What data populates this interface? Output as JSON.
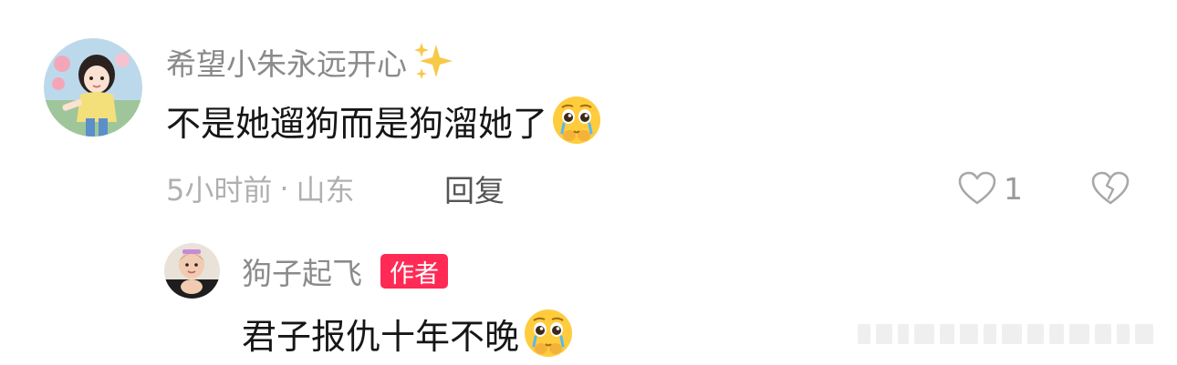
{
  "comment": {
    "username": "希望小朱永远开心",
    "content": "不是她遛狗而是狗溜她了",
    "emoji_icon": "crying-pleading-face-icon",
    "timestamp": "5小时前",
    "separator": "·",
    "location": "山东",
    "reply_label": "回复",
    "like_count": "1"
  },
  "reply": {
    "username": "狗子起飞",
    "badge": "作者",
    "content": "君子报仇十年不晚",
    "emoji_icon": "crying-pleading-face-icon"
  },
  "colors": {
    "badge_bg": "#ff2a55",
    "username": "#8a8a8a",
    "content": "#161616",
    "meta": "#b0b0b0"
  }
}
